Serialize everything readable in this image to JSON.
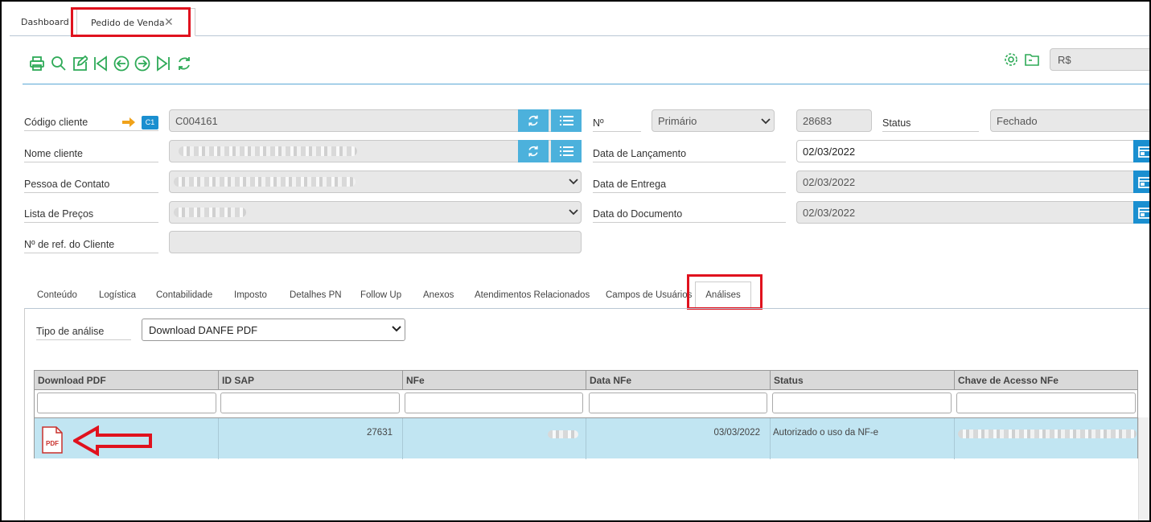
{
  "top_tabs": [
    {
      "label": "Dashboard"
    },
    {
      "label": "Pedido de Venda"
    }
  ],
  "toolbar": {
    "icons": [
      "printer-icon",
      "search-icon",
      "edit-icon",
      "first-record-icon",
      "previous-record-icon",
      "next-record-icon",
      "last-record-icon",
      "refresh-icon"
    ],
    "currency": "R$"
  },
  "form": {
    "codigo_cliente": {
      "label": "Código cliente",
      "badge": "C1",
      "value": "C004161"
    },
    "nome_cliente": {
      "label": "Nome cliente"
    },
    "pessoa_contato": {
      "label": "Pessoa de Contato"
    },
    "lista_precos": {
      "label": "Lista de Preços"
    },
    "ref_cliente": {
      "label": "Nº de ref. do Cliente",
      "value": ""
    },
    "numero": {
      "label": "Nº",
      "series": "Primário",
      "value": "28683"
    },
    "status": {
      "label": "Status",
      "value": "Fechado"
    },
    "data_lancamento": {
      "label": "Data de Lançamento",
      "value": "02/03/2022"
    },
    "data_entrega": {
      "label": "Data de Entrega",
      "value": "02/03/2022"
    },
    "data_documento": {
      "label": "Data do Documento",
      "value": "02/03/2022"
    }
  },
  "section_tabs": [
    "Conteúdo",
    "Logística",
    "Contabilidade",
    "Imposto",
    "Detalhes PN",
    "Follow Up",
    "Anexos",
    "Atendimentos Relacionados",
    "Campos de Usuários",
    "Análises"
  ],
  "analysis": {
    "label": "Tipo de análise",
    "selected": "Download DANFE PDF"
  },
  "grid": {
    "columns": [
      "Download PDF",
      "ID SAP",
      "NFe",
      "Data NFe",
      "Status",
      "Chave de Acesso NFe"
    ],
    "rows": [
      {
        "download": "PDF",
        "id_sap": "27631",
        "data_nfe": "03/03/2022",
        "status": "Autorizado o uso da NF-e"
      }
    ]
  },
  "colors": {
    "accent": "#4cb1dc",
    "calendar": "#1a8fd0",
    "highlight": "#e0121e",
    "icon_green": "#2eaa57",
    "row": "#c1e5f2"
  }
}
